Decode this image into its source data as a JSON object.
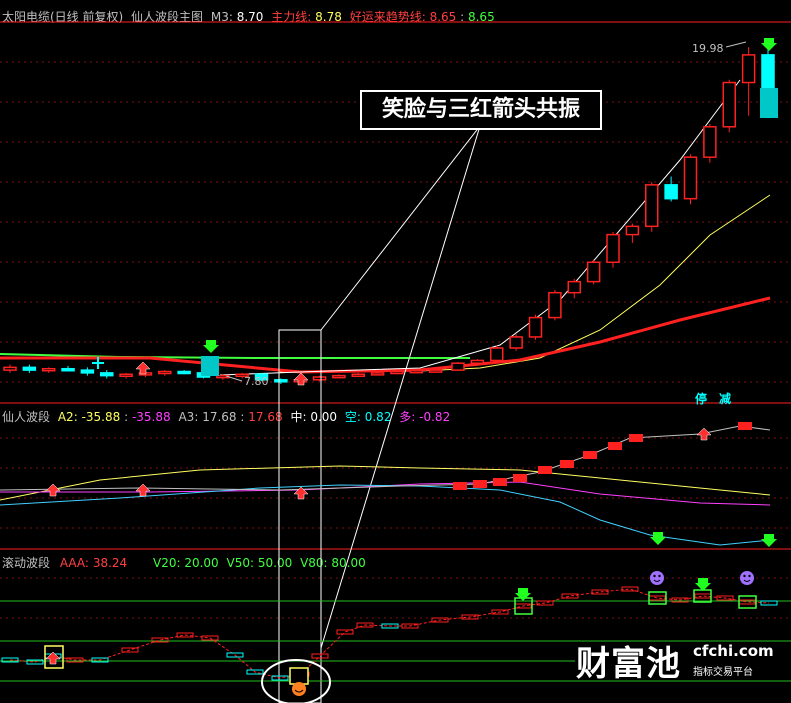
{
  "header": {
    "stock": "太阳电缆(日线 前复权)",
    "indicator": "仙人波段主图",
    "m3_label": "M3:",
    "m3_value": "8.70",
    "main_label": "主力线:",
    "main_value": "8.78",
    "good_label": "好运来趋势线:",
    "good_v1": "8.65",
    "good_v2": "8.65"
  },
  "panel2": {
    "title": "仙人波段",
    "a2_label": "A2:",
    "a2_value": "-35.88",
    "a2_value2": "-35.88",
    "a3_label": "A3:",
    "a3_value": "17.68",
    "a3_value2": "17.68",
    "zhong_label": "中:",
    "zhong_value": "0.00",
    "kong_label": "空:",
    "kong_value": "0.82",
    "duo_label": "多:",
    "duo_value": "-0.82"
  },
  "panel3": {
    "title": "滚动波段",
    "aaa_label": "AAA:",
    "aaa_value": "38.24",
    "v20": "V20: 20.00",
    "v50": "V50: 50.00",
    "v80": "V80: 80.00"
  },
  "callout": "笑脸与三红箭头共振",
  "annotations": {
    "high": "19.98",
    "low": "7.80",
    "sig1": "停",
    "sig2": "减"
  },
  "watermark": {
    "brand": "财富池",
    "url": "cfchi.com",
    "sub": "指标交易平台"
  },
  "colors": {
    "up": "#ff2020",
    "down": "#00ffff",
    "ma_yellow": "#ffff60",
    "ma_red": "#ff2020",
    "ma_green": "#40ff40",
    "panel_border": "#ff2020"
  },
  "chart_data": {
    "type": "candlestick",
    "panes": [
      "price",
      "仙人波段",
      "滚动波段"
    ],
    "price_high": 19.98,
    "price_low": 7.8,
    "ohlc": [
      [
        8.3,
        8.5,
        8.2,
        8.4
      ],
      [
        8.4,
        8.5,
        8.2,
        8.3
      ],
      [
        8.3,
        8.4,
        8.2,
        8.35
      ],
      [
        8.35,
        8.45,
        8.25,
        8.3
      ],
      [
        8.3,
        8.4,
        8.1,
        8.2
      ],
      [
        8.2,
        8.3,
        8.0,
        8.1
      ],
      [
        8.1,
        8.2,
        8.0,
        8.15
      ],
      [
        8.15,
        8.25,
        8.05,
        8.2
      ],
      [
        8.2,
        8.3,
        8.1,
        8.25
      ],
      [
        8.25,
        8.3,
        8.15,
        8.2
      ],
      [
        8.2,
        8.25,
        8.0,
        8.05
      ],
      [
        8.05,
        8.15,
        7.95,
        8.1
      ],
      [
        8.1,
        8.2,
        8.0,
        8.15
      ],
      [
        8.15,
        8.2,
        7.9,
        7.95
      ],
      [
        7.95,
        8.0,
        7.8,
        7.9
      ],
      [
        7.9,
        8.0,
        7.85,
        7.95
      ],
      [
        7.95,
        8.1,
        7.9,
        8.05
      ],
      [
        8.05,
        8.15,
        8.0,
        8.1
      ],
      [
        8.1,
        8.2,
        8.05,
        8.15
      ],
      [
        8.15,
        8.25,
        8.1,
        8.2
      ],
      [
        8.2,
        8.3,
        8.15,
        8.25
      ],
      [
        8.25,
        8.3,
        8.2,
        8.28
      ],
      [
        8.28,
        8.35,
        8.2,
        8.3
      ],
      [
        8.3,
        8.6,
        8.3,
        8.55
      ],
      [
        8.55,
        8.7,
        8.5,
        8.65
      ],
      [
        8.65,
        9.2,
        8.6,
        9.1
      ],
      [
        9.1,
        9.6,
        9.0,
        9.5
      ],
      [
        9.5,
        10.3,
        9.4,
        10.2
      ],
      [
        10.2,
        11.2,
        10.1,
        11.1
      ],
      [
        11.1,
        11.6,
        10.9,
        11.5
      ],
      [
        11.5,
        12.3,
        11.4,
        12.2
      ],
      [
        12.2,
        13.3,
        12.0,
        13.2
      ],
      [
        13.2,
        13.6,
        12.9,
        13.5
      ],
      [
        13.5,
        15.1,
        13.3,
        15.0
      ],
      [
        15.0,
        15.3,
        14.4,
        14.5
      ],
      [
        14.5,
        16.1,
        14.3,
        16.0
      ],
      [
        16.0,
        17.2,
        15.8,
        17.1
      ],
      [
        17.1,
        18.8,
        16.9,
        18.7
      ],
      [
        18.7,
        19.98,
        17.5,
        19.7
      ],
      [
        19.7,
        19.9,
        18.2,
        18.2
      ]
    ],
    "ma_white_bounds": [
      7.8,
      19.98
    ],
    "ma_yellow_end": 14.2,
    "ma_red_end": 11.8,
    "levels_panel3": [
      20,
      50,
      80
    ],
    "aaa": 38.24
  }
}
